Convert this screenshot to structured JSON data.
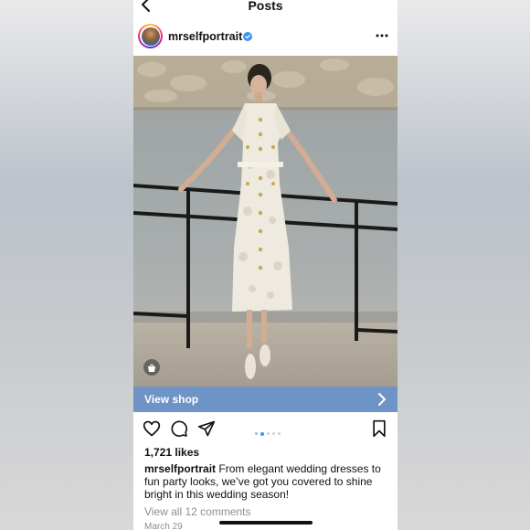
{
  "header": {
    "title": "Posts"
  },
  "post": {
    "username": "mrselfportrait",
    "view_shop_label": "View shop",
    "likes": "1,721 likes",
    "caption_user": "mrselfportrait",
    "caption_text": "From elegant wedding dresses to fun party looks, we’ve got you covered to shine bright in this wedding season!",
    "comments_link": "View all 12 comments",
    "date": "March 29",
    "carousel": {
      "current": 2,
      "total": 5
    }
  },
  "colors": {
    "view_shop_bg": "#6e93c6",
    "verified": "#3897f0",
    "carousel_active": "#3897f0"
  },
  "icons": [
    "back-icon",
    "verified-icon",
    "more-icon",
    "shopping-bag-icon",
    "chevron-right-icon",
    "heart-icon",
    "comment-icon",
    "share-icon",
    "bookmark-icon"
  ]
}
